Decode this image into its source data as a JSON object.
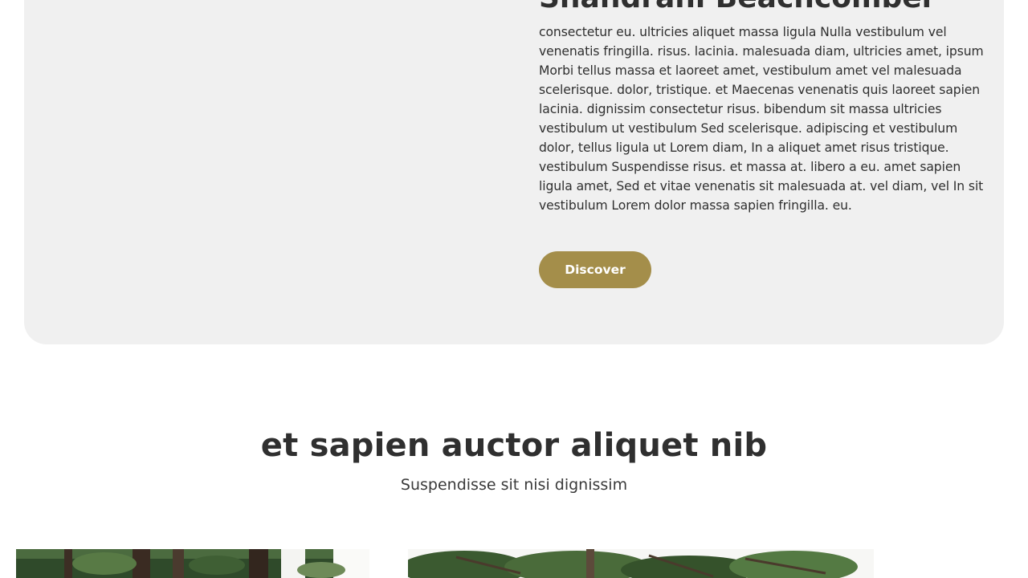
{
  "feature": {
    "title": "Shandrani Beachcomber",
    "body": "consectetur eu. ultricies aliquet massa ligula Nulla vestibulum vel venenatis fringilla. risus. lacinia. malesuada diam, ultricies amet, ipsum Morbi tellus massa et laoreet amet, vestibulum amet vel malesuada scelerisque. dolor, tristique. et Maecenas venenatis quis laoreet sapien lacinia. dignissim consectetur risus. bibendum sit massa ultricies vestibulum ut vestibulum Sed scelerisque. adipiscing et vestibulum dolor, tellus ligula ut Lorem diam, In a aliquet amet risus tristique. vestibulum Suspendisse risus. et massa at. libero a eu. amet sapien ligula amet, Sed et vitae venenatis sit malesuada at. vel diam, vel In sit vestibulum Lorem dolor massa sapien fringilla. eu.",
    "button_label": "Discover",
    "accent_color": "#a48e4a",
    "card_background": "#f0f0f0"
  },
  "section": {
    "heading": "et sapien auctor aliquet nib",
    "subheading": "Suspendisse sit nisi dignissim"
  },
  "gallery": {
    "images": [
      {
        "subject": "pine-forest-photo"
      },
      {
        "subject": "pine-tree-branches-photo"
      }
    ]
  }
}
